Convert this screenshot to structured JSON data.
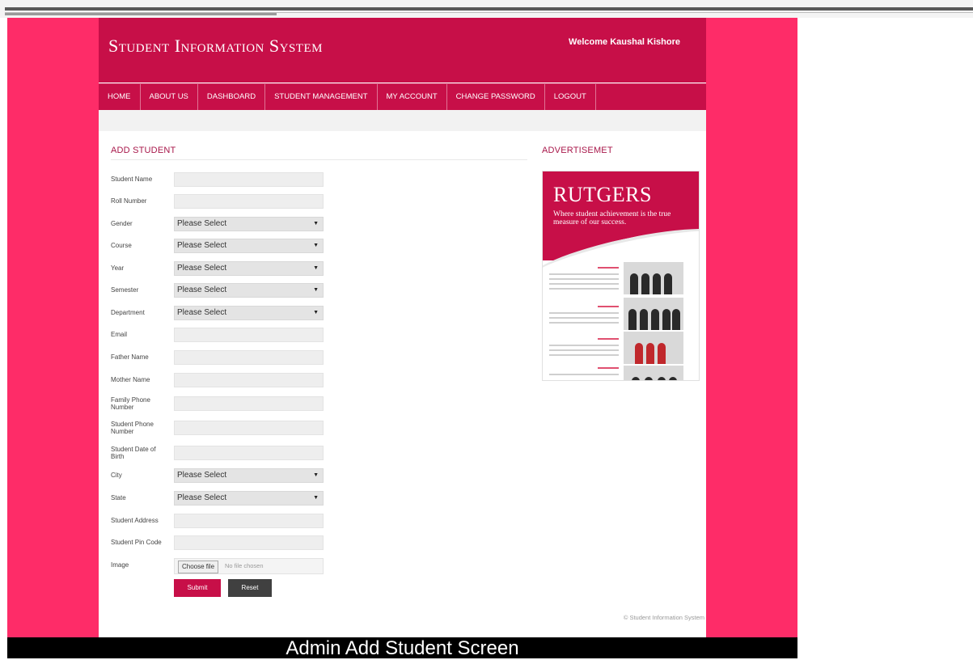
{
  "header": {
    "title": "Student Information System",
    "welcome": "Welcome Kaushal Kishore"
  },
  "nav": {
    "items": [
      {
        "label": "HOME"
      },
      {
        "label": "ABOUT US"
      },
      {
        "label": "DASHBOARD"
      },
      {
        "label": "STUDENT MANAGEMENT"
      },
      {
        "label": "MY ACCOUNT"
      },
      {
        "label": "CHANGE PASSWORD"
      },
      {
        "label": "LOGOUT"
      }
    ]
  },
  "form": {
    "title": "ADD STUDENT",
    "fields": {
      "student_name": {
        "label": "Student Name",
        "value": ""
      },
      "roll_number": {
        "label": "Roll Number",
        "value": ""
      },
      "gender": {
        "label": "Gender",
        "value": "Please Select"
      },
      "course": {
        "label": "Course",
        "value": "Please Select"
      },
      "year": {
        "label": "Year",
        "value": "Please Select"
      },
      "semester": {
        "label": "Semester",
        "value": "Please Select"
      },
      "department": {
        "label": "Department",
        "value": "Please Select"
      },
      "email": {
        "label": "Email",
        "value": ""
      },
      "father_name": {
        "label": "Father Name",
        "value": ""
      },
      "mother_name": {
        "label": "Mother Name",
        "value": ""
      },
      "family_phone": {
        "label": "Family Phone Number",
        "value": ""
      },
      "student_phone": {
        "label": "Student Phone Number",
        "value": ""
      },
      "dob": {
        "label": "Student Date of Birth",
        "value": ""
      },
      "city": {
        "label": "City",
        "value": "Please Select"
      },
      "state": {
        "label": "State",
        "value": "Please Select"
      },
      "address": {
        "label": "Student Address",
        "value": ""
      },
      "pin_code": {
        "label": "Student Pin Code",
        "value": ""
      },
      "image": {
        "label": "Image",
        "button": "Choose file",
        "status": "No file chosen"
      }
    },
    "submit_label": "Submit",
    "reset_label": "Reset"
  },
  "sidebar": {
    "title": "ADVERTISEMET",
    "ad": {
      "logo": "RUTGERS",
      "tagline": "Where student achievement is the true measure of our success."
    }
  },
  "footer": {
    "text": "© Student Information System"
  },
  "caption": "Admin Add Student Screen",
  "colors": {
    "brand": "#c70f48",
    "background": "#fe2c68",
    "reset_button": "#404040"
  }
}
